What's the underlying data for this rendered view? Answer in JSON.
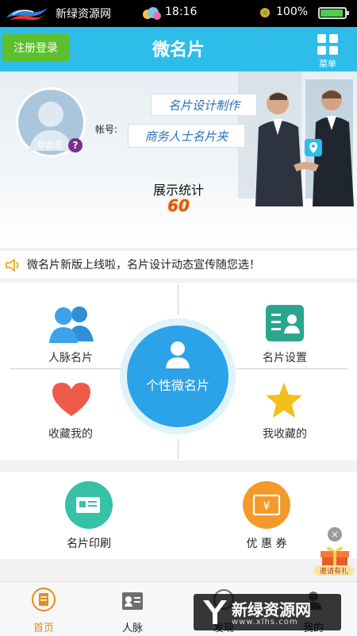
{
  "status_bar": {
    "site_name": "新绿资源网",
    "time": "18:16",
    "battery": "100%",
    "battery_level": 0.88
  },
  "header": {
    "login_button": "注册登录",
    "title": "微名片",
    "menu_label": "菜单"
  },
  "banner": {
    "member_badge": "非会员",
    "account_label": "帐号:",
    "slogan_line1": "名片设计制作",
    "slogan_line2": "商务人士名片夹",
    "stats_label": "展示统计",
    "stats_value": "60"
  },
  "notice": {
    "text": "微名片新版上线啦，名片设计动态宣传随您选！"
  },
  "grid": {
    "top_left": "人脉名片",
    "top_right": "名片设置",
    "center": "个性微名片",
    "bottom_left": "收藏我的",
    "bottom_right": "我收藏的"
  },
  "services": {
    "print": "名片印刷",
    "coupon": "优 惠 券"
  },
  "gift": {
    "label": "邀请有礼"
  },
  "bottom_nav": [
    {
      "label": "首页",
      "icon": "home-doc-icon",
      "active": true
    },
    {
      "label": "人脉",
      "icon": "contacts-card-icon",
      "active": false
    },
    {
      "label": "发现",
      "icon": "discover-icon",
      "active": false
    },
    {
      "label": "我的",
      "icon": "profile-icon",
      "active": false
    }
  ],
  "watermark": {
    "text": "新绿资源网",
    "sub": "www.xlhs.com"
  },
  "colors": {
    "header": "#2ebde8",
    "login": "#5bbf2e",
    "center_circle": "#2ca2e8",
    "active_nav": "#e58a1e"
  }
}
